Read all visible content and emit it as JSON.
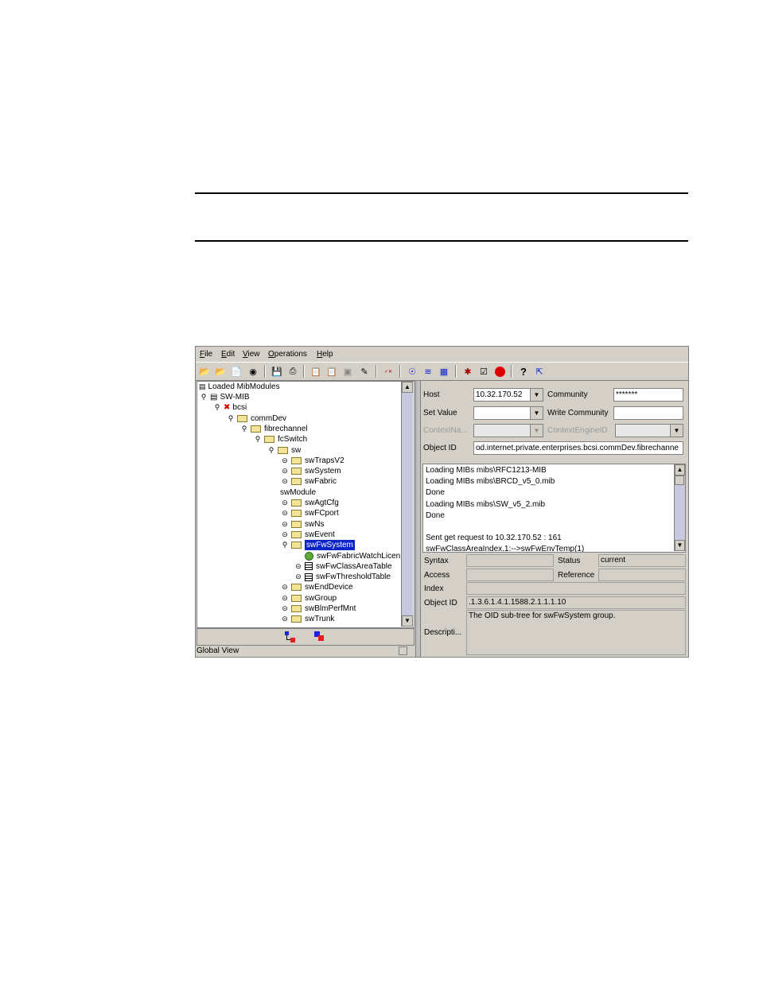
{
  "menubar": [
    "File",
    "Edit",
    "View",
    "Operations",
    "Help"
  ],
  "menu_mnemonic": [
    "F",
    "E",
    "V",
    "O",
    "H"
  ],
  "toolbar_icons": [
    "open-icon",
    "open-folder-icon",
    "load-mib-icon",
    "find-icon",
    "save-icon",
    "print-icon",
    "copy-icon",
    "paste-icon",
    "delete-icon",
    "edit-icon",
    "poll-icon",
    "graph-icon",
    "chart-icon",
    "table-icon",
    "trap-icon",
    "edit-node-icon",
    "stop-icon",
    "help-icon",
    "context-help-icon"
  ],
  "tree": {
    "root": "Loaded MibModules",
    "nodes": [
      {
        "label": "SW-MIB",
        "indent": 0
      },
      {
        "label": "bcsi",
        "indent": 1
      },
      {
        "label": "commDev",
        "indent": 2
      },
      {
        "label": "fibrechannel",
        "indent": 3
      },
      {
        "label": "fcSwitch",
        "indent": 4
      },
      {
        "label": "sw",
        "indent": 5
      },
      {
        "label": "swTrapsV2",
        "indent": 6
      },
      {
        "label": "swSystem",
        "indent": 6
      },
      {
        "label": "swFabric",
        "indent": 6
      },
      {
        "label": "swModule",
        "indent": 6
      },
      {
        "label": "swAgtCfg",
        "indent": 6
      },
      {
        "label": "swFCport",
        "indent": 6
      },
      {
        "label": "swNs",
        "indent": 6
      },
      {
        "label": "swEvent",
        "indent": 6
      },
      {
        "label": "swFwSystem",
        "indent": 6
      },
      {
        "label": "swFwFabricWatchLicen",
        "indent": 7
      },
      {
        "label": "swFwClassAreaTable",
        "indent": 7
      },
      {
        "label": "swFwThresholdTable",
        "indent": 7
      },
      {
        "label": "swEndDevice",
        "indent": 6
      },
      {
        "label": "swGroup",
        "indent": 6
      },
      {
        "label": "swBlmPerfMnt",
        "indent": 6
      },
      {
        "label": "swTrunk",
        "indent": 6
      }
    ]
  },
  "status_bar": "Global View",
  "form": {
    "host_label": "Host",
    "host_value": "10.32.170.52",
    "community_label": "Community",
    "community_value": "*******",
    "setvalue_label": "Set Value",
    "setvalue_value": "",
    "writecommunity_label": "Write Community",
    "writecommunity_value": "",
    "contextname_label": "ContextNa...",
    "contextengine_label": "ContextEngineID",
    "objectid_label": "Object ID",
    "objectid_value": "od.internet.private.enterprises.bcsi.commDev.fibrechanne"
  },
  "log_lines": [
    "Loading MIBs mibs\\RFC1213-MIB",
    "Loading MIBs mibs\\BRCD_v5_0.mib",
    "Done",
    "Loading MIBs mibs\\SW_v5_2.mib",
    "Done",
    "",
    "Sent get request to 10.32.170.52 : 161",
    "swFwClassAreaIndex.1:-->swFwEnvTemp(1)"
  ],
  "props": {
    "syntax_label": "Syntax",
    "syntax_value": "",
    "status_label": "Status",
    "status_value": "current",
    "access_label": "Access",
    "access_value": "",
    "reference_label": "Reference",
    "reference_value": "",
    "index_label": "Index",
    "index_value": "",
    "objectid_label": "Object ID",
    "objectid_value": ".1.3.6.1.4.1.1588.2.1.1.1.10",
    "description_label": "Descripti...",
    "description_value": "The OID sub-tree for swFwSystem group."
  }
}
